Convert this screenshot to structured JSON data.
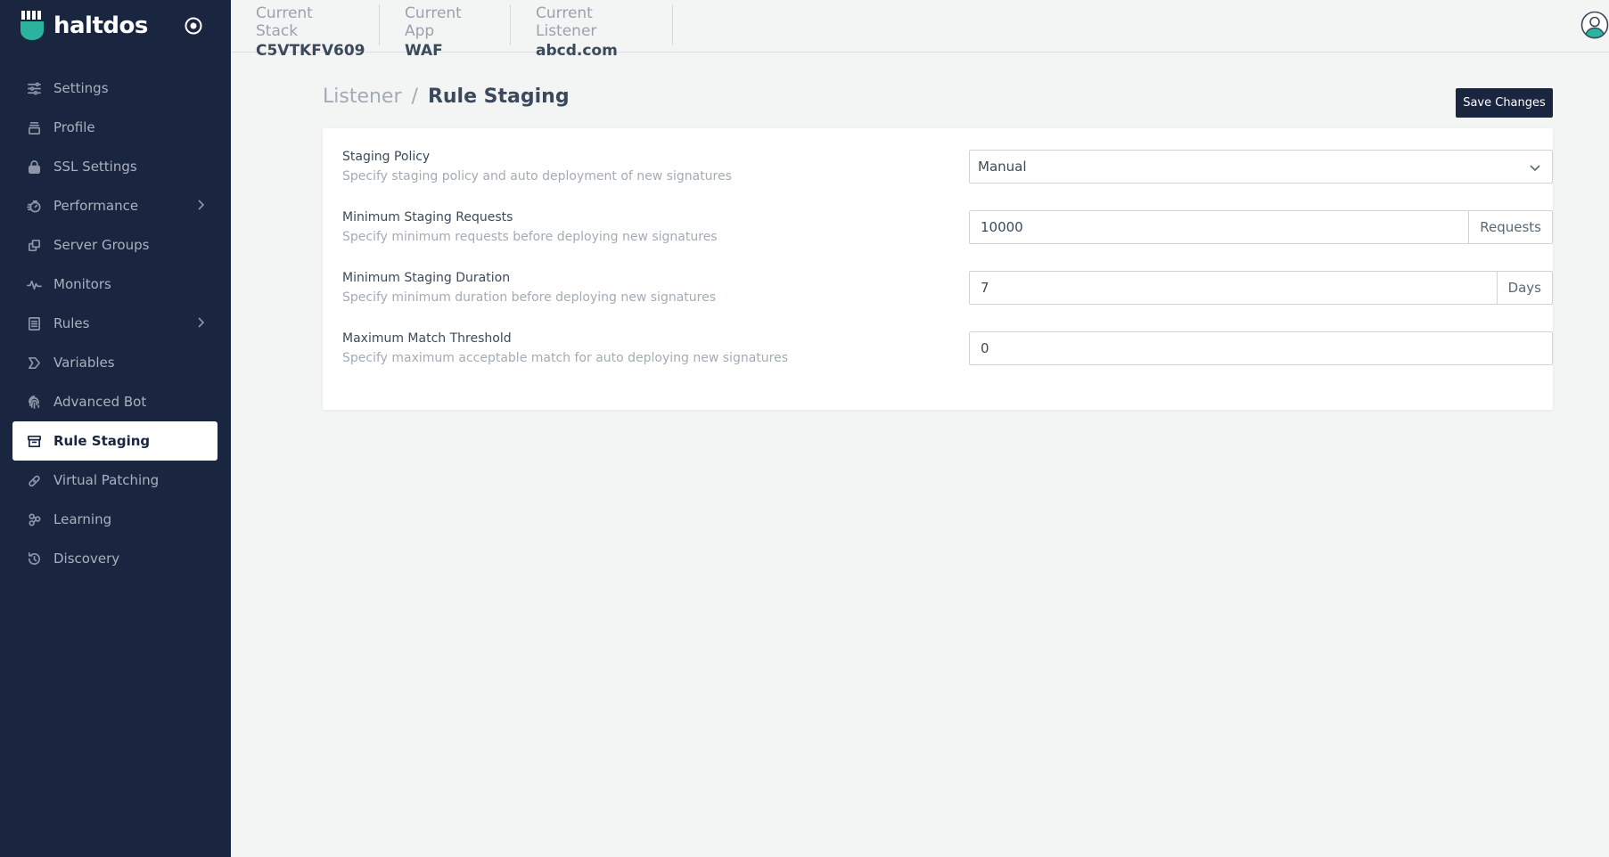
{
  "brand": {
    "name": "haltdos"
  },
  "sidebar": {
    "items": [
      {
        "label": "Settings",
        "icon": "sliders-icon",
        "has_submenu": false
      },
      {
        "label": "Profile",
        "icon": "stack-icon",
        "has_submenu": false
      },
      {
        "label": "SSL Settings",
        "icon": "lock-icon",
        "has_submenu": false
      },
      {
        "label": "Performance",
        "icon": "speedometer-icon",
        "has_submenu": true
      },
      {
        "label": "Server Groups",
        "icon": "copy-icon",
        "has_submenu": false
      },
      {
        "label": "Monitors",
        "icon": "pulse-icon",
        "has_submenu": false
      },
      {
        "label": "Rules",
        "icon": "list-icon",
        "has_submenu": true
      },
      {
        "label": "Variables",
        "icon": "tag-icon",
        "has_submenu": false
      },
      {
        "label": "Advanced Bot",
        "icon": "fingerprint-icon",
        "has_submenu": false
      },
      {
        "label": "Rule Staging",
        "icon": "archive-icon",
        "has_submenu": false,
        "active": true
      },
      {
        "label": "Virtual Patching",
        "icon": "bandage-icon",
        "has_submenu": false
      },
      {
        "label": "Learning",
        "icon": "molecule-icon",
        "has_submenu": false
      },
      {
        "label": "Discovery",
        "icon": "history-icon",
        "has_submenu": false
      }
    ]
  },
  "topbar": {
    "stack": {
      "label": "Current Stack",
      "value": "C5VTKFV609"
    },
    "app": {
      "label": "Current App",
      "value": "WAF"
    },
    "listener": {
      "label": "Current Listener",
      "value": "abcd.com"
    }
  },
  "page": {
    "breadcrumb_parent": "Listener",
    "breadcrumb_separator": "/",
    "title": "Rule Staging",
    "save_label": "Save Changes"
  },
  "form": {
    "staging_policy": {
      "label": "Staging Policy",
      "description": "Specify staging policy and auto deployment of new signatures",
      "value": "Manual"
    },
    "min_requests": {
      "label": "Minimum Staging Requests",
      "description": "Specify minimum requests before deploying new signatures",
      "value": "10000",
      "unit": "Requests"
    },
    "min_duration": {
      "label": "Minimum Staging Duration",
      "description": "Specify minimum duration before deploying new signatures",
      "value": "7",
      "unit": "Days"
    },
    "max_threshold": {
      "label": "Maximum Match Threshold",
      "description": "Specify maximum acceptable match for auto deploying new signatures",
      "value": "0"
    }
  },
  "colors": {
    "sidebar_bg": "#1a2640",
    "brand_accent": "#2bb3a0",
    "page_bg": "#f3f4f4",
    "button_bg": "#1a2640"
  }
}
